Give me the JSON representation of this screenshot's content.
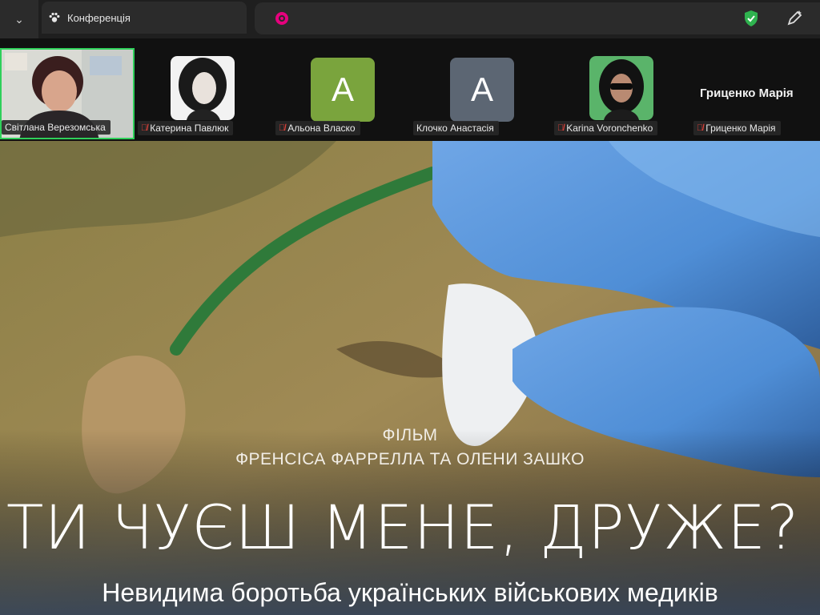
{
  "browser": {
    "tab_title": "Конференція",
    "menu_glyph": "⌄"
  },
  "participants": [
    {
      "name": "Світлана Верезомська",
      "muted": false,
      "kind": "video"
    },
    {
      "name": "Катерина Павлюк",
      "muted": true,
      "kind": "photo"
    },
    {
      "name": "Альона Власко",
      "muted": true,
      "kind": "avatar",
      "initial": "A",
      "color": "#7aa43d"
    },
    {
      "name": "Клочко Анастасія",
      "muted": false,
      "kind": "avatar",
      "initial": "A",
      "color": "#5c6673"
    },
    {
      "name": "Karina Voronchenko",
      "muted": true,
      "kind": "photo"
    },
    {
      "name": "Гриценко Марія",
      "muted": true,
      "kind": "name",
      "display": "Гриценко Марія"
    }
  ],
  "poster": {
    "kicker_line1": "ФІЛЬМ",
    "kicker_line2": "ФРЕНСІСА ФАРРЕЛЛА ТА ОЛЕНИ ЗАШКО",
    "title": "ТИ ЧУЄШ МЕНЕ, ДРУЖЕ?",
    "subtitle": "Невидима боротьба українських військових медиків"
  },
  "colors": {
    "active_speaker_border": "#2fd05a",
    "muted_mic": "#e8423a",
    "glove_blue": "#4f8ed6"
  }
}
